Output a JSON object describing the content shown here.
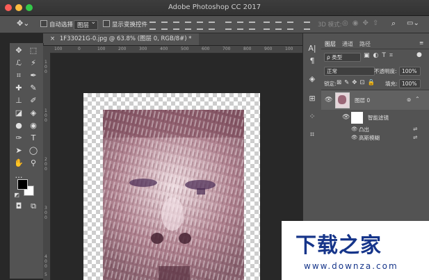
{
  "app": {
    "title": "Adobe Photoshop CC 2017"
  },
  "options_bar": {
    "auto_select_label": "自动选择:",
    "auto_select_value": "图层",
    "show_transform_label": "显示变换控件",
    "mode_3d_label": "3D 模式:"
  },
  "document": {
    "tab_label": "1F33021G-0.jpg @ 63.8% (图层 0, RGB/8#) *",
    "close_glyph": "×",
    "ruler_top": [
      "100",
      "0",
      "100",
      "200",
      "300",
      "400",
      "500",
      "600",
      "700",
      "800",
      "900",
      "100"
    ],
    "ruler_left": [
      "1",
      "0",
      "0",
      "1",
      "0",
      "0",
      "2",
      "0",
      "0",
      "3",
      "0",
      "0",
      "4",
      "0",
      "0",
      "5"
    ]
  },
  "layers_panel": {
    "tabs": [
      "图层",
      "通道",
      "路径"
    ],
    "filter_kind": "ρ 类型",
    "blend_mode": "正常",
    "opacity_label": "不透明度:",
    "opacity_value": "100%",
    "lock_label": "锁定:",
    "fill_label": "填充:",
    "fill_value": "100%",
    "layer_name": "图层 0",
    "smart_filters_label": "智能滤镜",
    "filters": [
      "凸出",
      "高斯模糊"
    ]
  },
  "watermark": {
    "brand": "下载之家",
    "url": "www.downza.com"
  },
  "colors": {
    "foreground": "#000000",
    "background": "#ffffff",
    "brand": "#16358a"
  }
}
